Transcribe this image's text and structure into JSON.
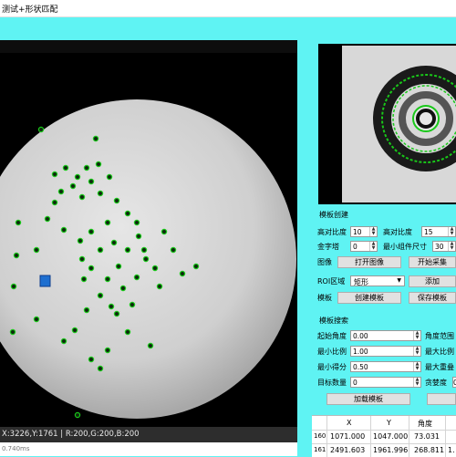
{
  "window": {
    "title": "测试+形状匹配"
  },
  "status": {
    "readout": "X:3226,Y:1761 | R:200,G:200,B:200",
    "bottom_text": "0.740ms"
  },
  "template_create": {
    "title": "模板创建",
    "contrast_label": "高对比度",
    "contrast_low": "10",
    "contrast_high_label": "高对比度",
    "contrast_high": "15",
    "pyramid_label": "金字塔",
    "pyramid_value": "0",
    "min_component_label": "最小组件尺寸",
    "min_component_value": "30",
    "image_label": "图像",
    "open_image_button": "打开图像",
    "start_capture_button": "开始采集",
    "roi_label": "ROI区域",
    "roi_shape": "矩形",
    "add_button": "添加",
    "template_label": "模板",
    "create_template_button": "创建模板",
    "save_template_button": "保存模板"
  },
  "template_search": {
    "title": "模板搜索",
    "start_angle_label": "起始角度",
    "start_angle": "0.00",
    "angle_range_label": "角度范围",
    "min_scale_label": "最小比例",
    "min_scale": "1.00",
    "max_scale_label": "最大比例",
    "min_score_label": "最小得分",
    "min_score": "0.50",
    "max_overlap_label": "最大重叠",
    "target_count_label": "目标数量",
    "target_count": "0",
    "greediness_label": "贪婪度",
    "greediness": "0",
    "load_template_button": "加载模板"
  },
  "results_table": {
    "columns": [
      "",
      "X",
      "Y",
      "角度",
      ""
    ],
    "rows": [
      [
        "160",
        "1071.000",
        "1047.000",
        "73.031",
        ""
      ],
      [
        "161",
        "2491.603",
        "1961.996",
        "268.811",
        "1."
      ]
    ]
  },
  "colors": {
    "accent": "#5ff3f3",
    "match": "#19c819",
    "roi": "#1e6fd0"
  }
}
